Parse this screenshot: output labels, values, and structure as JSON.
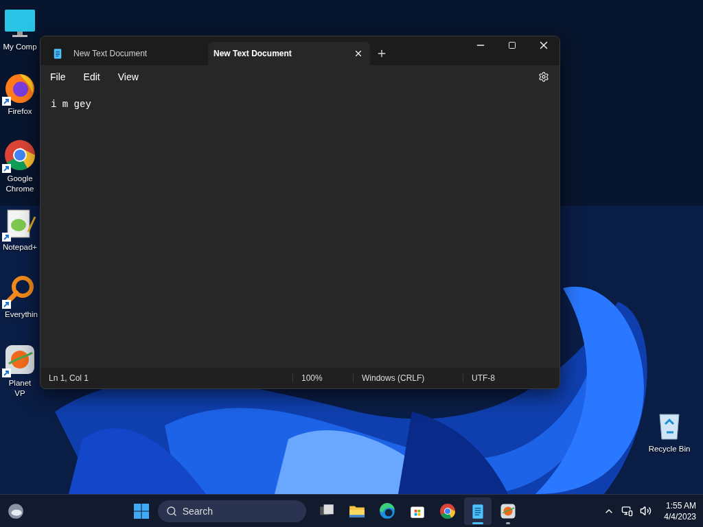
{
  "desktop_icons": [
    {
      "kind": "computer",
      "label": "My Comp",
      "shortcut": false
    },
    {
      "kind": "firefox",
      "label": "Firefox",
      "shortcut": true
    },
    {
      "kind": "chrome",
      "label": "Google Chrome",
      "shortcut": true
    },
    {
      "kind": "notepadpp",
      "label": "Notepad+",
      "shortcut": true
    },
    {
      "kind": "everything",
      "label": "Everythin",
      "shortcut": true
    },
    {
      "kind": "planet",
      "label": "Planet VP",
      "shortcut": true
    }
  ],
  "recycle_bin": {
    "label": "Recycle Bin"
  },
  "window": {
    "tabs": [
      {
        "title": "New Text Document",
        "selected": false
      },
      {
        "title": "New Text Document",
        "selected": true
      }
    ],
    "menu": [
      "File",
      "Edit",
      "View"
    ],
    "editor": {
      "value": "i m gey"
    },
    "status_bar": [
      "Ln 1, Col 1",
      "100%",
      "Windows (CRLF)",
      "UTF-8"
    ]
  },
  "taskbar": {
    "search": {
      "placeholder": "Search"
    },
    "apps": [
      {
        "kind": "taskview",
        "active": false,
        "running": false
      },
      {
        "kind": "explorer",
        "active": false,
        "running": false
      },
      {
        "kind": "edge",
        "active": false,
        "running": false
      },
      {
        "kind": "store",
        "active": false,
        "running": false
      },
      {
        "kind": "chrome",
        "active": false,
        "running": false
      },
      {
        "kind": "notepad",
        "active": true,
        "running": true
      },
      {
        "kind": "planet",
        "active": false,
        "running": true
      }
    ],
    "time": "1:55 AM",
    "date": "4/4/2023"
  }
}
